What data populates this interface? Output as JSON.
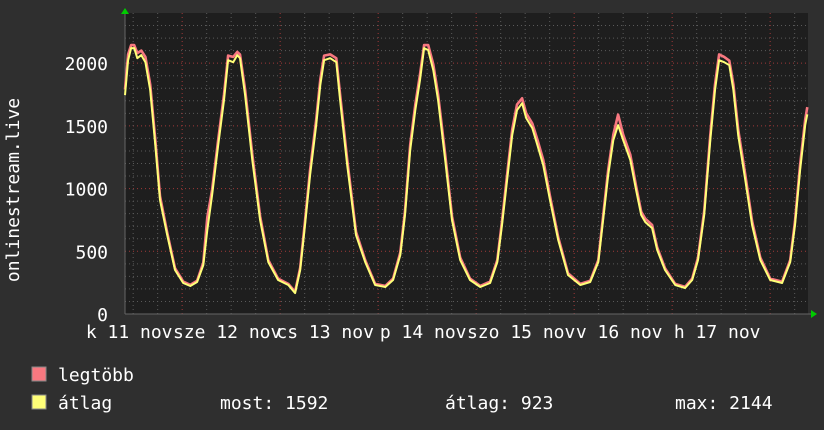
{
  "chart_data": {
    "type": "line",
    "ylabel": "onlinestream.live",
    "ylim": [
      0,
      2400
    ],
    "yticks": [
      "0",
      "500",
      "1000",
      "1500",
      "2000"
    ],
    "ytick_values": [
      0,
      500,
      1000,
      1500,
      2000
    ],
    "xlim": [
      "11 nov 10:00",
      "18 nov 09:20"
    ],
    "xticks": [
      {
        "label": "k 11 nov",
        "time": "11 nov 12:00"
      },
      {
        "label": "sze 12 nov",
        "time": "12 nov 12:00"
      },
      {
        "label": "cs 13 nov",
        "time": "13 nov 12:00"
      },
      {
        "label": "p 14 nov",
        "time": "14 nov 12:00"
      },
      {
        "label": "szo 15 nov",
        "time": "15 nov 12:00"
      },
      {
        "label": "v 16 nov",
        "time": "16 nov 12:00"
      },
      {
        "label": "h 17 nov",
        "time": "17 nov 12:00"
      }
    ],
    "grid": true,
    "x": [
      "11 nov 10:00",
      "11 nov 10:45",
      "11 nov 11:30",
      "11 nov 12:15",
      "11 nov 13:00",
      "11 nov 14:00",
      "11 nov 15:00",
      "11 nov 16:10",
      "11 nov 17:25",
      "11 nov 18:35",
      "11 nov 20:20",
      "11 nov 22:15",
      "12 nov 00:15",
      "12 nov 02:00",
      "12 nov 03:40",
      "12 nov 05:10",
      "12 nov 06:10",
      "12 nov 07:20",
      "12 nov 08:50",
      "12 nov 10:15",
      "12 nov 11:15",
      "12 nov 12:30",
      "12 nov 13:30",
      "12 nov 14:10",
      "12 nov 15:25",
      "12 nov 17:10",
      "12 nov 19:05",
      "12 nov 21:05",
      "12 nov 23:30",
      "13 nov 02:00",
      "13 nov 03:40",
      "13 nov 04:55",
      "13 nov 06:05",
      "13 nov 07:20",
      "13 nov 08:50",
      "13 nov 09:50",
      "13 nov 10:45",
      "13 nov 12:15",
      "13 nov 13:45",
      "13 nov 14:40",
      "13 nov 16:25",
      "13 nov 18:35",
      "13 nov 20:50",
      "13 nov 23:15",
      "14 nov 01:45",
      "14 nov 03:40",
      "14 nov 05:25",
      "14 nov 06:35",
      "14 nov 07:50",
      "14 nov 09:05",
      "14 nov 10:15",
      "14 nov 11:15",
      "14 nov 12:15",
      "14 nov 13:30",
      "14 nov 14:40",
      "14 nov 16:25",
      "14 nov 18:05",
      "14 nov 20:05",
      "14 nov 22:30",
      "15 nov 01:00",
      "15 nov 03:25",
      "15 nov 05:10",
      "15 nov 06:20",
      "15 nov 07:35",
      "15 nov 08:50",
      "15 nov 10:00",
      "15 nov 11:15",
      "15 nov 12:15",
      "15 nov 13:45",
      "15 nov 15:00",
      "15 nov 16:25",
      "15 nov 18:05",
      "15 nov 20:05",
      "15 nov 22:30",
      "16 nov 01:30",
      "16 nov 03:55",
      "16 nov 05:55",
      "16 nov 07:05",
      "16 nov 08:20",
      "16 nov 09:35",
      "16 nov 10:45",
      "16 nov 12:00",
      "16 nov 13:45",
      "16 nov 15:10",
      "16 nov 16:25",
      "16 nov 17:25",
      "16 nov 19:05",
      "16 nov 20:20",
      "16 nov 22:15",
      "17 nov 00:45",
      "17 nov 03:10",
      "17 nov 04:55",
      "17 nov 06:20",
      "17 nov 07:50",
      "17 nov 09:20",
      "17 nov 10:30",
      "17 nov 11:30",
      "17 nov 12:45",
      "17 nov 14:00",
      "17 nov 15:00",
      "17 nov 16:10",
      "17 nov 17:55",
      "17 nov 19:35",
      "17 nov 21:35",
      "18 nov 00:00",
      "18 nov 02:55",
      "18 nov 04:55",
      "18 nov 06:05",
      "18 nov 07:20",
      "18 nov 08:35",
      "18 nov 09:05"
    ],
    "series": [
      {
        "name": "legtöbb",
        "color": "#f87880",
        "values": [
          1790,
          2070,
          2144,
          2144,
          2080,
          2100,
          2050,
          1830,
          1390,
          940,
          650,
          365,
          258,
          232,
          265,
          410,
          770,
          990,
          1390,
          1750,
          2060,
          2050,
          2090,
          2070,
          1790,
          1270,
          780,
          430,
          282,
          240,
          178,
          370,
          740,
          1150,
          1550,
          1870,
          2060,
          2070,
          2040,
          1750,
          1230,
          655,
          430,
          240,
          224,
          282,
          490,
          820,
          1350,
          1670,
          1910,
          2144,
          2144,
          1990,
          1750,
          1270,
          780,
          450,
          282,
          224,
          258,
          430,
          740,
          1110,
          1470,
          1670,
          1720,
          1600,
          1520,
          1390,
          1230,
          940,
          612,
          325,
          240,
          265,
          430,
          780,
          1150,
          1430,
          1590,
          1430,
          1270,
          1020,
          815,
          760,
          710,
          530,
          365,
          240,
          216,
          282,
          450,
          820,
          1430,
          1830,
          2070,
          2050,
          2020,
          1830,
          1470,
          1110,
          740,
          450,
          282,
          258,
          430,
          740,
          1190,
          1550,
          1650
        ]
      },
      {
        "name": "átlag",
        "color": "#ffff78",
        "values": [
          1745,
          2024,
          2120,
          2120,
          2040,
          2064,
          2008,
          1785,
          1347,
          908,
          630,
          351,
          247,
          223,
          255,
          390,
          669,
          948,
          1347,
          1705,
          2024,
          2008,
          2064,
          2040,
          1745,
          1227,
          749,
          414,
          271,
          231,
          167,
          351,
          709,
          1108,
          1506,
          1825,
          2024,
          2040,
          2008,
          1705,
          1187,
          630,
          414,
          231,
          215,
          271,
          470,
          789,
          1307,
          1625,
          1865,
          2120,
          2104,
          1944,
          1705,
          1227,
          749,
          430,
          271,
          215,
          247,
          414,
          709,
          1068,
          1426,
          1625,
          1681,
          1562,
          1482,
          1347,
          1187,
          908,
          590,
          311,
          231,
          255,
          414,
          749,
          1108,
          1386,
          1506,
          1386,
          1227,
          988,
          789,
          733,
          685,
          510,
          351,
          231,
          207,
          271,
          430,
          789,
          1386,
          1785,
          2024,
          2008,
          1984,
          1785,
          1426,
          1068,
          709,
          430,
          271,
          247,
          414,
          709,
          1147,
          1506,
          1592
        ]
      }
    ],
    "legend": {
      "placement": "bottom-left",
      "entries": [
        {
          "label": "legtöbb",
          "color": "#f87880"
        },
        {
          "label": "átlag",
          "color": "#ffff78"
        }
      ],
      "stats": {
        "most": "most: 1592",
        "atlag": "átlag: 923",
        "max": "max: 2144"
      }
    }
  },
  "colors": {
    "background": "#2f2f2f",
    "plot_background": "#1e1e1e",
    "minor_grid": "#5a5a5a",
    "major_grid": "#a03838",
    "axis_arrow": "#00cc00"
  }
}
